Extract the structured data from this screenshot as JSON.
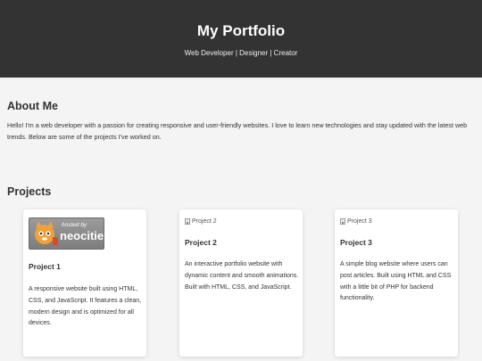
{
  "header": {
    "title": "My Portfolio",
    "tagline": "Web Developer | Designer | Creator"
  },
  "about": {
    "heading": "About Me",
    "text": "Hello! I'm a web developer with a passion for creating responsive and user-friendly websites. I love to learn new technologies and stay updated with the latest web trends. Below are some of the projects I've worked on."
  },
  "projects": {
    "heading": "Projects",
    "items": [
      {
        "title": "Project 1",
        "description": "A responsive website built using HTML, CSS, and JavaScript. It features a clean, modern design and is optimized for all devices.",
        "badge_hosted": "hosted by",
        "badge_name": "neocities"
      },
      {
        "title": "Project 2",
        "image_alt": "Project 2",
        "description": "An interactive portfolio website with dynamic content and smooth animations. Built with HTML, CSS, and JavaScript."
      },
      {
        "title": "Project 3",
        "image_alt": "Project 3",
        "description": "A simple blog website where users can post articles. Built using HTML and CSS with a little bit of PHP for backend functionality."
      }
    ]
  },
  "colors": {
    "header_bg": "#333333",
    "page_bg": "#f4f4f4",
    "card_bg": "#ffffff"
  }
}
